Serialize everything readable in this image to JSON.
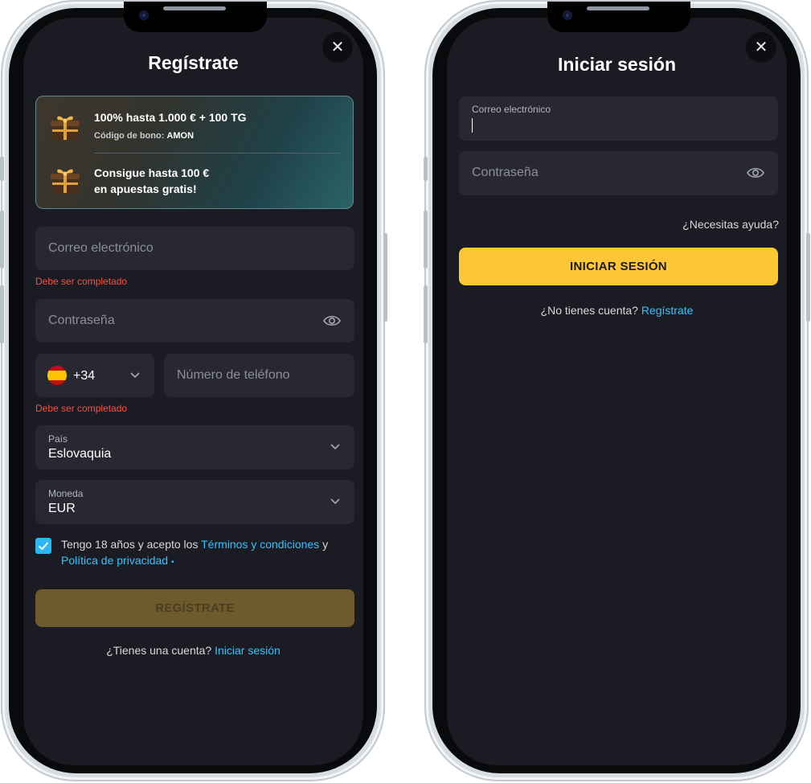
{
  "register": {
    "title": "Regístrate",
    "close_icon": "close-icon",
    "bonus": {
      "line1": "100% hasta 1.000 € + 100 TG",
      "code_label": "Código de bono:",
      "code_value": "AMON",
      "line3a": "Consigue hasta 100 €",
      "line3b": "en apuestas gratis!"
    },
    "email_placeholder": "Correo electrónico",
    "email_error": "Debe ser completado",
    "password_placeholder": "Contraseña",
    "phone_code": "+34",
    "phone_placeholder": "Número de teléfono",
    "phone_error": "Debe ser completado",
    "country_label": "País",
    "country_value": "Eslovaquia",
    "currency_label": "Moneda",
    "currency_value": "EUR",
    "terms_prefix": "Tengo 18 años y acepto los",
    "terms_link": "Términos y condiciones",
    "terms_and": "y",
    "privacy_link": "Política de privacidad",
    "privacy_marker": "•",
    "submit_label": "REGÍSTRATE",
    "footer_text": "¿Tienes una cuenta?",
    "footer_link": "Iniciar sesión"
  },
  "login": {
    "title": "Iniciar sesión",
    "email_label": "Correo electrónico",
    "password_placeholder": "Contraseña",
    "help_link": "¿Necesitas ayuda?",
    "submit_label": "INICIAR SESIÓN",
    "footer_text": "¿No tienes cuenta?",
    "footer_link": "Regístrate"
  },
  "colors": {
    "background": "#1a1b23",
    "field": "#272832",
    "accent_yellow": "#ffc635",
    "accent_yellow_disabled": "#6e5a2c",
    "link": "#33c4ff",
    "error": "#ff4d3d",
    "checkbox": "#2bb8f0"
  }
}
